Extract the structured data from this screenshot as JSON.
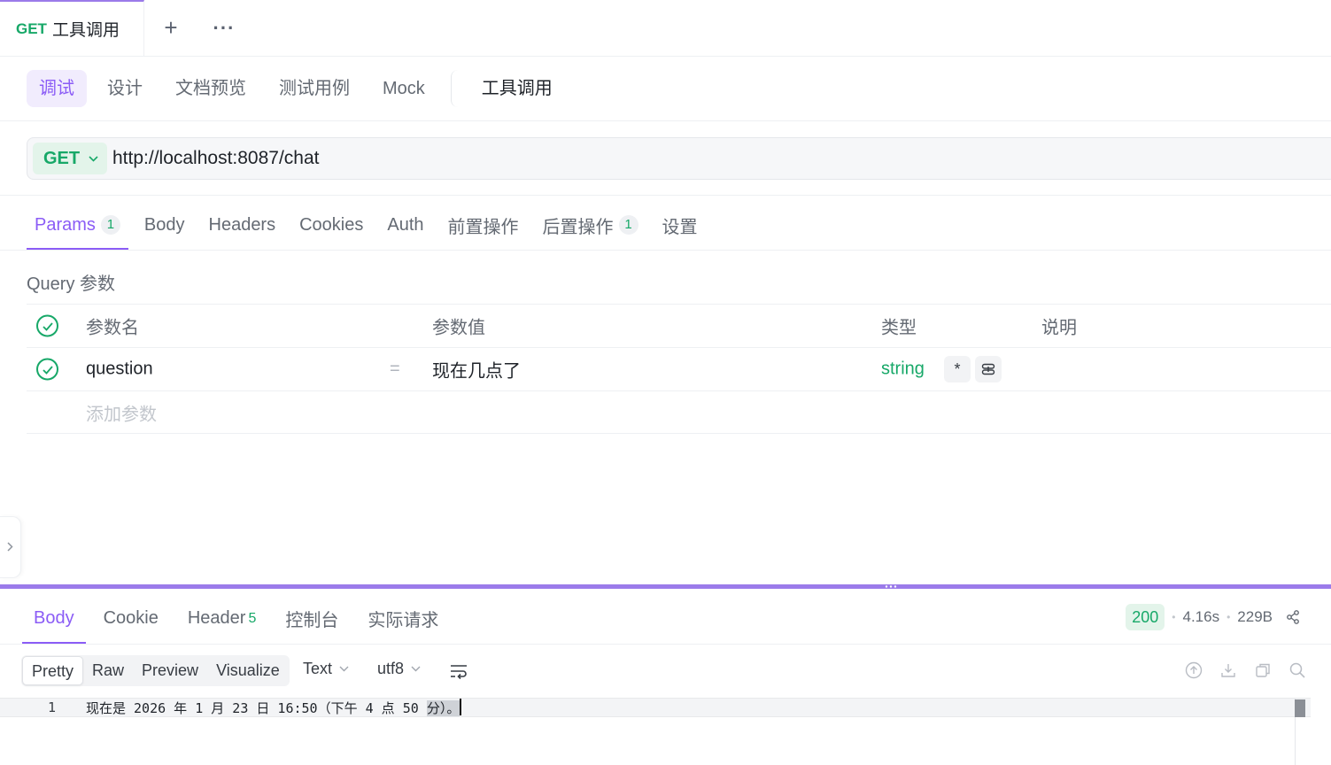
{
  "tabstrip": {
    "request_tab": {
      "method": "GET",
      "name": "工具调用"
    },
    "add_label": "+",
    "more_label": "···"
  },
  "mode_tabs": [
    {
      "label": "调试",
      "active": true
    },
    {
      "label": "设计"
    },
    {
      "label": "文档预览"
    },
    {
      "label": "测试用例"
    },
    {
      "label": "Mock"
    },
    {
      "label": "工具调用"
    }
  ],
  "url_bar": {
    "method": "GET",
    "url": "http://localhost:8087/chat"
  },
  "param_tabs": [
    {
      "label": "Params",
      "count": "1",
      "active": true
    },
    {
      "label": "Body"
    },
    {
      "label": "Headers"
    },
    {
      "label": "Cookies"
    },
    {
      "label": "Auth"
    },
    {
      "label": "前置操作"
    },
    {
      "label": "后置操作",
      "count": "1"
    },
    {
      "label": "设置"
    }
  ],
  "query": {
    "section_label": "Query 参数",
    "headers": {
      "name": "参数名",
      "value": "参数值",
      "type": "类型",
      "desc": "说明"
    },
    "rows": [
      {
        "name": "question",
        "eq": "=",
        "value": "现在几点了",
        "type": "string",
        "required": "*"
      }
    ],
    "add_placeholder": "添加参数"
  },
  "response": {
    "tabs": [
      {
        "label": "Body",
        "active": true
      },
      {
        "label": "Cookie"
      },
      {
        "label": "Header",
        "count": "5"
      },
      {
        "label": "控制台"
      },
      {
        "label": "实际请求"
      }
    ],
    "status": "200",
    "time": "4.16s",
    "size": "229B",
    "views": [
      "Pretty",
      "Raw",
      "Preview",
      "Visualize"
    ],
    "active_view": "Pretty",
    "format": "Text",
    "encoding": "utf8",
    "line_number": "1",
    "body_text": "现在是 2026 年 1 月 23 日 16:50（下午 4 点 50 ",
    "body_selected": "分）。"
  },
  "colors": {
    "accent": "#8b5cf6",
    "method_green": "#17a868",
    "splitter": "#9b7bea"
  },
  "icons": [
    "plus-icon",
    "more-icon",
    "chevron-down-icon",
    "check-icon",
    "link-icon",
    "share-icon",
    "wrap-icon",
    "upload-icon",
    "download-icon",
    "copy-icon",
    "search-icon",
    "chevron-right-icon"
  ]
}
